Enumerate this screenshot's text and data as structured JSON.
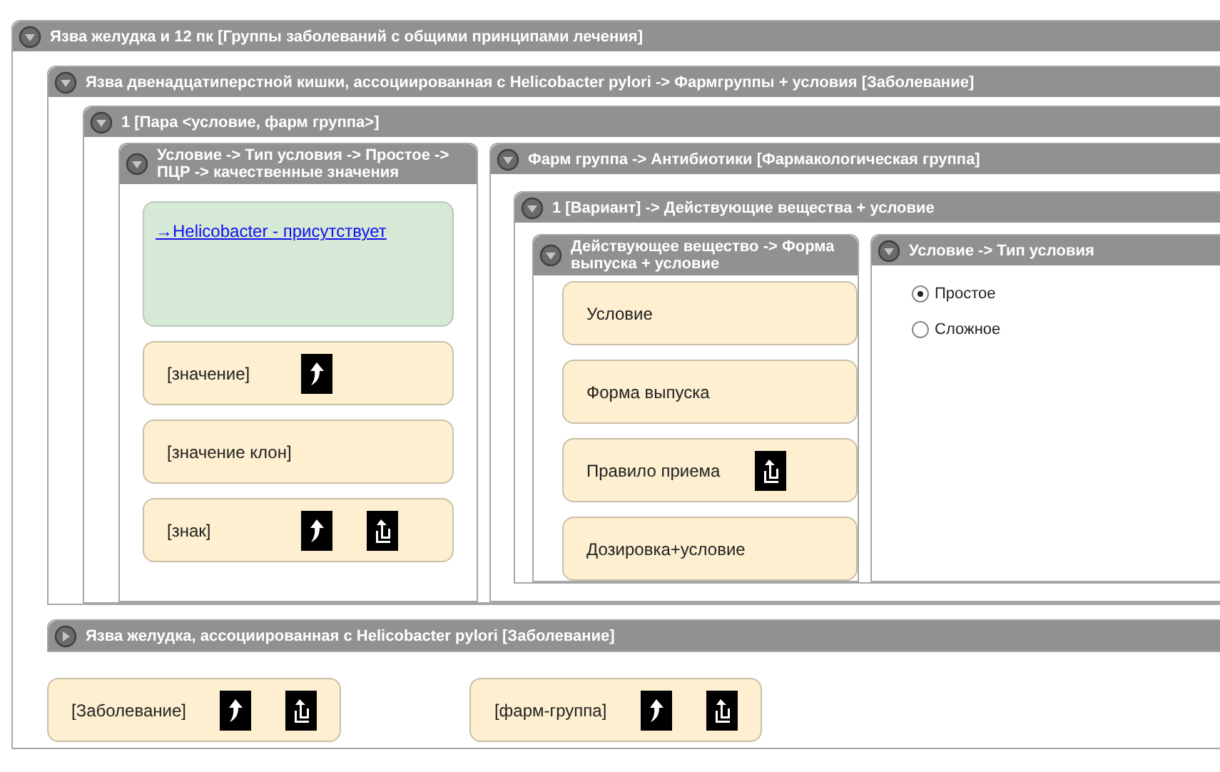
{
  "tree": {
    "kind": "group",
    "title": "Язва желудка и 12 пк [Группы заболеваний с общими принципами лечения]",
    "expanded": true,
    "children": [
      {
        "kind": "group",
        "title": "Язва двенадцатиперстной кишки, ассоциированная с Helicobacter pylori  ->  Фармгруппы + условия [Заболевание]",
        "expanded": true,
        "children": [
          {
            "kind": "group",
            "title": "1 [Пара <условие, фарм группа>]",
            "expanded": true,
            "children": [
              {
                "kind": "group",
                "title": "Условие -> Тип условия -> Простое -> ПЦР -> качественные значения",
                "expanded": true,
                "children": [
                  {
                    "kind": "link_box",
                    "link": "→Helicobacter - присутствует"
                  },
                  {
                    "kind": "card",
                    "label": "[значение]",
                    "actions": [
                      {
                        "kind": "up"
                      }
                    ]
                  },
                  {
                    "kind": "card",
                    "label": "[значение клон]"
                  },
                  {
                    "kind": "card",
                    "label": "[знак]",
                    "actions": [
                      {
                        "kind": "up"
                      },
                      {
                        "kind": "return"
                      }
                    ]
                  }
                ]
              },
              {
                "kind": "group",
                "title": "Фарм группа -> Антибиотики [Фармакологическая группа]",
                "expanded": true,
                "children": [
                  {
                    "kind": "group",
                    "title": "1 [Вариант] -> Действующие вещества + условие",
                    "expanded": true,
                    "children": [
                      {
                        "kind": "group",
                        "title": "Действующее вещество -> Форма выпуска + условие",
                        "expanded": true,
                        "children": [
                          {
                            "kind": "card",
                            "label": "Условие"
                          },
                          {
                            "kind": "card",
                            "label": "Форма выпуска"
                          },
                          {
                            "kind": "card",
                            "label": "Правило приема",
                            "actions": [
                              {
                                "kind": "return"
                              }
                            ]
                          },
                          {
                            "kind": "card",
                            "label": "Дозировка+условие"
                          }
                        ]
                      },
                      {
                        "kind": "group",
                        "title": "Условие -> Тип условия",
                        "expanded": true,
                        "children": [
                          {
                            "kind": "radio_group",
                            "options": [
                              {
                                "label": "Простое",
                                "selected": true
                              },
                              {
                                "label": "Сложное",
                                "selected": false
                              }
                            ]
                          }
                        ]
                      }
                    ]
                  }
                ]
              }
            ]
          }
        ]
      },
      {
        "kind": "group",
        "title": "Язва желудка, ассоциированная с Helicobacter pylori  [Заболевание]",
        "expanded": false
      },
      {
        "kind": "card",
        "label": "[Заболевание]",
        "actions": [
          {
            "kind": "up"
          },
          {
            "kind": "return"
          }
        ]
      },
      {
        "kind": "card",
        "label": "[фарм-группа]",
        "actions": [
          {
            "kind": "up"
          },
          {
            "kind": "return"
          }
        ]
      }
    ]
  }
}
